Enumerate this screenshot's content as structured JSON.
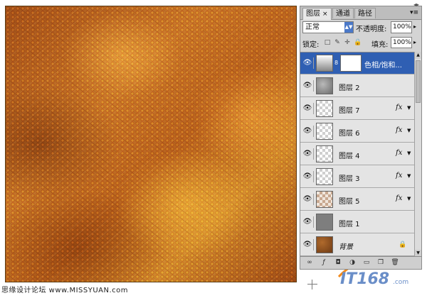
{
  "panel": {
    "tabs": [
      {
        "label": "图层",
        "close": "×"
      },
      {
        "label": "通道"
      },
      {
        "label": "路径"
      }
    ],
    "menu_icon": "▾≡",
    "collapse_icon": "◂▸"
  },
  "blend": {
    "mode": "正常",
    "opacity_label": "不透明度:",
    "opacity_value": "100%"
  },
  "lock": {
    "label": "锁定:",
    "fill_label": "填充:",
    "fill_value": "100%"
  },
  "layers": [
    {
      "name": "色相/饱和...",
      "thumb": "adjust",
      "selected": true,
      "adjustment": true
    },
    {
      "name": "图层 2",
      "thumb": "gray-cloud"
    },
    {
      "name": "图层 7",
      "thumb": "checker",
      "fx": "fx"
    },
    {
      "name": "图层 6",
      "thumb": "checker",
      "fx": "fx"
    },
    {
      "name": "图层 4",
      "thumb": "checker",
      "fx": "fx"
    },
    {
      "name": "图层 3",
      "thumb": "checker",
      "fx": "fx"
    },
    {
      "name": "图层 5",
      "thumb": "checker-warm",
      "fx": "fx"
    },
    {
      "name": "图层 1",
      "thumb": "gray-solid"
    },
    {
      "name": "背景",
      "thumb": "brown",
      "locked": true,
      "italic": true
    }
  ],
  "watermark": "思缘设计论坛 www.MISSYUAN.com",
  "brand": "IT168",
  "brand_sub": ".com",
  "colors": {
    "selection": "#2f5fb3",
    "accent_orange": "#f28a1c"
  }
}
